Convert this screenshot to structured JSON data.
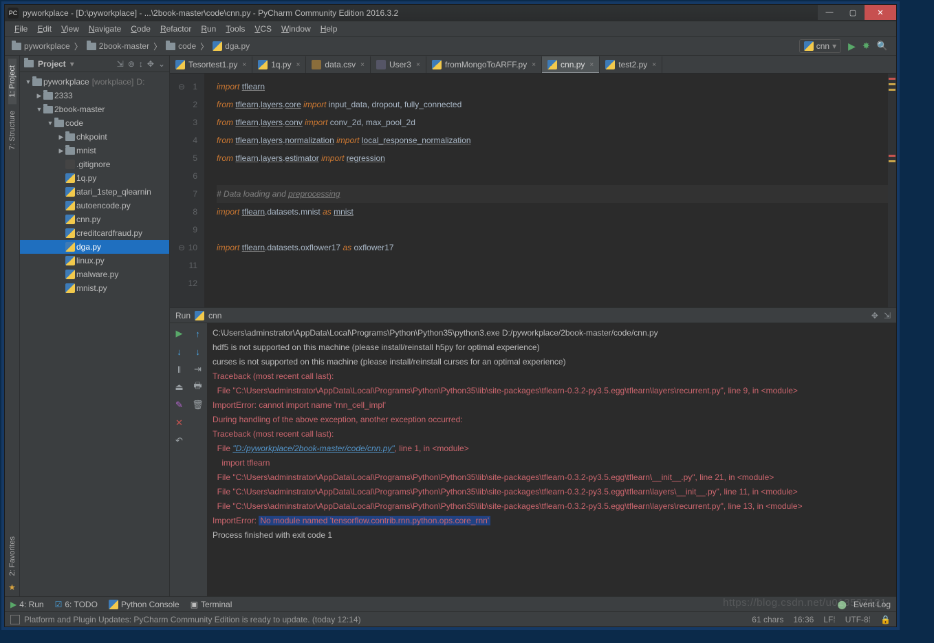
{
  "title": "pyworkplace - [D:\\pyworkplace] - ...\\2book-master\\code\\cnn.py - PyCharm Community Edition 2016.3.2",
  "menu": [
    "File",
    "Edit",
    "View",
    "Navigate",
    "Code",
    "Refactor",
    "Run",
    "Tools",
    "VCS",
    "Window",
    "Help"
  ],
  "breadcrumbs": [
    {
      "icon": "folder",
      "label": "pyworkplace"
    },
    {
      "icon": "folder",
      "label": "2book-master"
    },
    {
      "icon": "folder",
      "label": "code"
    },
    {
      "icon": "py",
      "label": "dga.py"
    }
  ],
  "runconfig": "cnn",
  "left_tabs": [
    "1: Project",
    "7: Structure",
    "2: Favorites"
  ],
  "project_header": "Project",
  "tree": [
    {
      "indent": 0,
      "tw": "▼",
      "icon": "folder",
      "label": "pyworkplace",
      "suffix": "[workplace]",
      "suffix2": "D:"
    },
    {
      "indent": 1,
      "tw": "▶",
      "icon": "folder",
      "label": "2333"
    },
    {
      "indent": 1,
      "tw": "▼",
      "icon": "folder",
      "label": "2book-master"
    },
    {
      "indent": 2,
      "tw": "▼",
      "icon": "folder",
      "label": "code"
    },
    {
      "indent": 3,
      "tw": "▶",
      "icon": "folder",
      "label": "chkpoint"
    },
    {
      "indent": 3,
      "tw": "▶",
      "icon": "folder",
      "label": "mnist"
    },
    {
      "indent": 3,
      "tw": "",
      "icon": "git",
      "label": ".gitignore"
    },
    {
      "indent": 3,
      "tw": "",
      "icon": "py",
      "label": "1q.py"
    },
    {
      "indent": 3,
      "tw": "",
      "icon": "py",
      "label": "atari_1step_qlearnin"
    },
    {
      "indent": 3,
      "tw": "",
      "icon": "py",
      "label": "autoencode.py"
    },
    {
      "indent": 3,
      "tw": "",
      "icon": "py",
      "label": "cnn.py"
    },
    {
      "indent": 3,
      "tw": "",
      "icon": "py",
      "label": "creditcardfraud.py"
    },
    {
      "indent": 3,
      "tw": "",
      "icon": "py",
      "label": "dga.py",
      "sel": true
    },
    {
      "indent": 3,
      "tw": "",
      "icon": "py",
      "label": "linux.py"
    },
    {
      "indent": 3,
      "tw": "",
      "icon": "py",
      "label": "malware.py"
    },
    {
      "indent": 3,
      "tw": "",
      "icon": "py",
      "label": "mnist.py"
    }
  ],
  "tabs": [
    {
      "icon": "py",
      "label": "Tesortest1.py"
    },
    {
      "icon": "py",
      "label": "1q.py"
    },
    {
      "icon": "csv",
      "label": "data.csv"
    },
    {
      "icon": "usr",
      "label": "User3"
    },
    {
      "icon": "py",
      "label": "fromMongoToARFF.py"
    },
    {
      "icon": "py",
      "label": "cnn.py",
      "active": true
    },
    {
      "icon": "py",
      "label": "test2.py"
    }
  ],
  "gutter_lines": 12,
  "code": [
    {
      "n": 1,
      "fold": "⊖",
      "html": "<span class='kw'>import</span> <span class='ul'>tflearn</span>"
    },
    {
      "n": 2,
      "html": "<span class='kw'>from</span> <span class='ul'>tflearn</span>.<span class='ul'>layers</span>.<span class='ul'>core</span> <span class='kw'>import</span> input_data, dropout, fully_connected"
    },
    {
      "n": 3,
      "html": "<span class='kw'>from</span> <span class='ul'>tflearn</span>.<span class='ul'>layers</span>.<span class='ul'>conv</span> <span class='kw'>import</span> conv_2d, max_pool_2d"
    },
    {
      "n": 4,
      "html": "<span class='kw'>from</span> <span class='ul'>tflearn</span>.<span class='ul'>layers</span>.<span class='ul'>normalization</span> <span class='kw'>import</span> <span class='ul'>local_response_normalization</span>"
    },
    {
      "n": 5,
      "html": "<span class='kw'>from</span> <span class='ul'>tflearn</span>.<span class='ul'>layers</span>.<span class='ul'>estimator</span> <span class='kw'>import</span> <span class='ul'>regression</span>"
    },
    {
      "n": 6,
      "html": ""
    },
    {
      "n": 7,
      "hl": true,
      "html": "<span class='cm'># Data loading and <span class='ul'>preprocessing</span></span>"
    },
    {
      "n": 8,
      "html": "<span class='kw'>import</span> <span class='ul'>tflearn</span>.datasets.mnist <span class='kw'>as</span> <span class='ul'>mnist</span>"
    },
    {
      "n": 9,
      "html": ""
    },
    {
      "n": 10,
      "fold": "⊖",
      "html": "<span class='kw'>import</span> <span class='ul'>tflearn</span>.datasets.oxflower17 <span class='kw'>as</span> oxflower17"
    },
    {
      "n": 11,
      "html": ""
    },
    {
      "n": 12,
      "html": ""
    }
  ],
  "run_header": {
    "label": "Run",
    "target": "cnn"
  },
  "console": [
    {
      "cls": "path",
      "text": "C:\\Users\\adminstrator\\AppData\\Local\\Programs\\Python\\Python35\\python3.exe D:/pyworkplace/2book-master/code/cnn.py"
    },
    {
      "cls": "warn",
      "text": "hdf5 is not supported on this machine (please install/reinstall h5py for optimal experience)"
    },
    {
      "cls": "warn",
      "text": "curses is not supported on this machine (please install/reinstall curses for an optimal experience)"
    },
    {
      "cls": "err",
      "text": "Traceback (most recent call last):"
    },
    {
      "cls": "err",
      "text": "  File \"C:\\Users\\adminstrator\\AppData\\Local\\Programs\\Python\\Python35\\lib\\site-packages\\tflearn-0.3.2-py3.5.egg\\tflearn\\layers\\recurrent.py\", line 9, in <module>"
    },
    {
      "cls": "err",
      "text": "ImportError: cannot import name 'rnn_cell_impl'"
    },
    {
      "cls": "",
      "text": ""
    },
    {
      "cls": "err",
      "text": "During handling of the above exception, another exception occurred:"
    },
    {
      "cls": "",
      "text": ""
    },
    {
      "cls": "err",
      "text": "Traceback (most recent call last):"
    },
    {
      "cls": "err",
      "html": "  File <span class='link'>\"D:/pyworkplace/2book-master/code/cnn.py\"</span>, line 1, in &lt;module&gt;"
    },
    {
      "cls": "err",
      "text": "    import tflearn"
    },
    {
      "cls": "err",
      "text": "  File \"C:\\Users\\adminstrator\\AppData\\Local\\Programs\\Python\\Python35\\lib\\site-packages\\tflearn-0.3.2-py3.5.egg\\tflearn\\__init__.py\", line 21, in <module>"
    },
    {
      "cls": "err",
      "text": "  File \"C:\\Users\\adminstrator\\AppData\\Local\\Programs\\Python\\Python35\\lib\\site-packages\\tflearn-0.3.2-py3.5.egg\\tflearn\\layers\\__init__.py\", line 11, in <module>"
    },
    {
      "cls": "err",
      "text": "  File \"C:\\Users\\adminstrator\\AppData\\Local\\Programs\\Python\\Python35\\lib\\site-packages\\tflearn-0.3.2-py3.5.egg\\tflearn\\layers\\recurrent.py\", line 13, in <module>"
    },
    {
      "cls": "err",
      "html": "ImportError: <span class='hlblock'>No module named 'tensorflow.contrib.rnn.python.ops.core_rnn'</span>"
    },
    {
      "cls": "",
      "text": ""
    },
    {
      "cls": "path",
      "text": "Process finished with exit code 1"
    }
  ],
  "bottom_tools": [
    "4: Run",
    "6: TODO",
    "Python Console",
    "Terminal"
  ],
  "event_log": "Event Log",
  "status_msg": "Platform and Plugin Updates: PyCharm Community Edition is ready to update. (today 12:14)",
  "status_right": [
    "61 chars",
    "16:36",
    "LF⁞",
    "UTF-8⁞",
    "🔒"
  ],
  "watermark": "https://blog.csdn.net/u013537121"
}
